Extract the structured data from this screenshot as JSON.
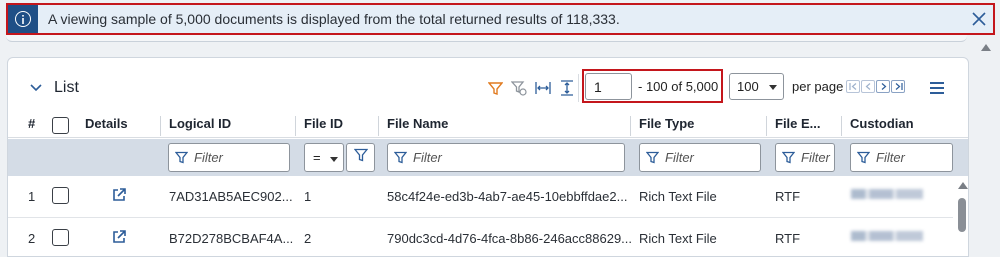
{
  "banner": {
    "message": "A viewing sample of 5,000 documents is displayed from the total returned results of 118,333.",
    "icon": "info-icon",
    "close_icon": "close-icon"
  },
  "list": {
    "title": "List",
    "toolbar_icons": [
      "filter-icon",
      "clear-filter-icon",
      "fit-columns-icon",
      "fit-rows-icon"
    ],
    "pager": {
      "page_value": "1",
      "range_text": "- 100 of 5,000",
      "per_page_value": "100",
      "per_page_label": "per page"
    },
    "columns": [
      {
        "label": "#"
      },
      {
        "label": "Details"
      },
      {
        "label": "Logical ID"
      },
      {
        "label": "File ID"
      },
      {
        "label": "File Name"
      },
      {
        "label": "File Type"
      },
      {
        "label": "File E..."
      },
      {
        "label": "Custodian"
      }
    ],
    "filter_placeholder": "Filter",
    "file_id_operator": "=",
    "rows": [
      {
        "num": "1",
        "logical_id": "7AD31AB5AEC902...",
        "file_id": "1",
        "file_name": "58c4f24e-ed3b-4ab7-ae45-10ebbffdae2...",
        "file_type": "Rich Text File",
        "file_ext": "RTF"
      },
      {
        "num": "2",
        "logical_id": "B72D278BCBAF4A...",
        "file_id": "2",
        "file_name": "790dc3cd-4d76-4fca-8b86-246acc88629...",
        "file_type": "Rich Text File",
        "file_ext": "RTF"
      }
    ]
  },
  "colors": {
    "highlight": "#c4161c",
    "banner_icon_bg": "#1f4f86",
    "filter_row_bg": "#d4dce6",
    "accent_orange": "#e07a1f",
    "link_blue": "#2d5d99"
  }
}
